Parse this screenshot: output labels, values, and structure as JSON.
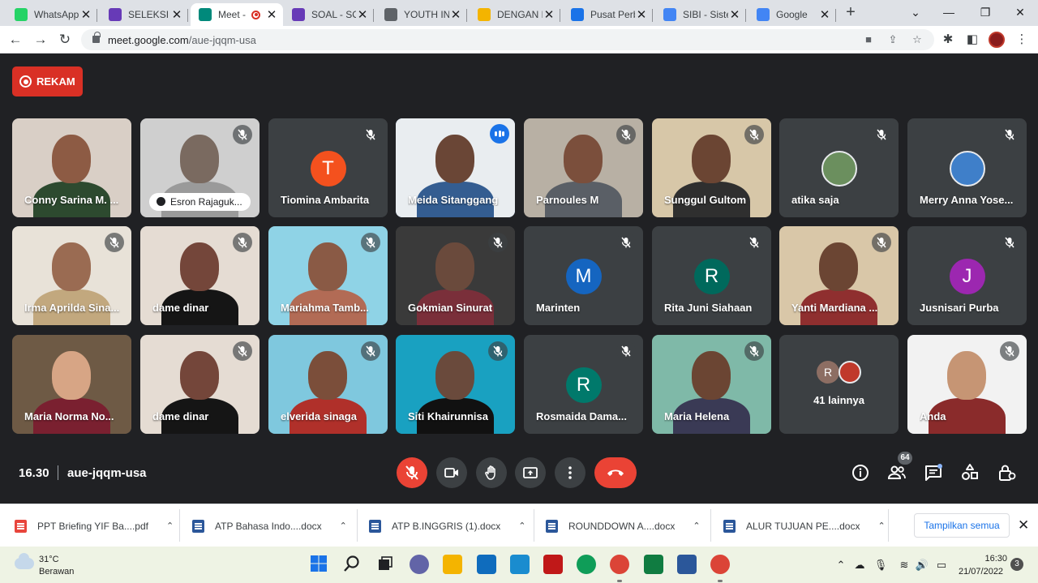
{
  "browser": {
    "tabs": [
      {
        "title": "WhatsApp",
        "favicon_color": "#25d366"
      },
      {
        "title": "SELEKSI TA",
        "favicon_color": "#673ab7"
      },
      {
        "title": "Meet -",
        "favicon_color": "#00897b",
        "recording": true,
        "active": true
      },
      {
        "title": "SOAL - SO",
        "favicon_color": "#673ab7"
      },
      {
        "title": "YOUTH IN",
        "favicon_color": "#5f6368"
      },
      {
        "title": "DENGAN E",
        "favicon_color": "#f4b400"
      },
      {
        "title": "Pusat Perb",
        "favicon_color": "#1a73e8"
      },
      {
        "title": "SIBI - Siste",
        "favicon_color": "#4285f4"
      },
      {
        "title": "Google",
        "favicon_color": "#4285f4"
      }
    ],
    "tab_close_glyph": "✕",
    "url_host": "meet.google.com",
    "url_path": "/aue-jqqm-usa"
  },
  "meet": {
    "record_label": "REKAM",
    "rows": [
      [
        {
          "name": "Conny Sarina M. ...",
          "kind": "video",
          "bg": "#d9cfc6",
          "skin": "#8d5b44",
          "cloth": "#2d4a2f",
          "mute": false
        },
        {
          "name": "Esron Rajaguk...",
          "kind": "video",
          "bg": "#cfcfcf",
          "skin": "#7a6a60",
          "cloth": "#9a9a9a",
          "mute": true,
          "pill": true
        },
        {
          "name": "Tiomina Ambarita",
          "kind": "avatar",
          "letter": "T",
          "color": "#f4511e",
          "mute": true
        },
        {
          "name": "Meida Sitanggang",
          "kind": "video",
          "bg": "#e9edf0",
          "skin": "#6a4636",
          "cloth": "#345d91",
          "mute": false,
          "speaking": true
        },
        {
          "name": "Parnoules M",
          "kind": "video",
          "bg": "#b8b0a4",
          "skin": "#7b4f3c",
          "cloth": "#5a5f66",
          "mute": true
        },
        {
          "name": "Sunggul Gultom",
          "kind": "video",
          "bg": "#d7c7a8",
          "skin": "#6b4533",
          "cloth": "#2f2f2f",
          "mute": true
        },
        {
          "name": "atika saja",
          "kind": "photo",
          "color": "#6b8f5e",
          "mute": true
        },
        {
          "name": "Merry Anna Yose...",
          "kind": "photo",
          "color": "#3f7fc9",
          "mute": true
        }
      ],
      [
        {
          "name": "Irma Aprilda Sina...",
          "kind": "video",
          "bg": "#e8e2d8",
          "skin": "#9a6b52",
          "cloth": "#c2a87e",
          "mute": true
        },
        {
          "name": "dame dinar",
          "kind": "video",
          "bg": "#e5dcd3",
          "skin": "#74463a",
          "cloth": "#151515",
          "mute": true
        },
        {
          "name": "Mariahma Tamb...",
          "kind": "video",
          "bg": "#8fd3e6",
          "skin": "#8a5a45",
          "cloth": "#b26b55",
          "mute": true
        },
        {
          "name": "Gokmian Sinurat",
          "kind": "video",
          "bg": "#3a3a3a",
          "skin": "#6a4a3c",
          "cloth": "#7a2f3a",
          "mute": true
        },
        {
          "name": "Marinten",
          "kind": "avatar",
          "letter": "M",
          "color": "#1565c0",
          "mute": true
        },
        {
          "name": "Rita Juni Siahaan",
          "kind": "avatar",
          "letter": "R",
          "color": "#00695c",
          "mute": true
        },
        {
          "name": "Yanti Mardiana ...",
          "kind": "video",
          "bg": "#d9c7a8",
          "skin": "#6b4533",
          "cloth": "#8f2f2f",
          "mute": true
        },
        {
          "name": "Jusnisari Purba",
          "kind": "avatar",
          "letter": "J",
          "color": "#9c27b0",
          "mute": true
        }
      ],
      [
        {
          "name": "Maria Norma No...",
          "kind": "video",
          "bg": "#6e5a45",
          "skin": "#d7a585",
          "cloth": "#7a2030",
          "mute": false
        },
        {
          "name": "dame dinar",
          "kind": "video",
          "bg": "#e5dcd3",
          "skin": "#74463a",
          "cloth": "#151515",
          "mute": true
        },
        {
          "name": "elverida sinaga",
          "kind": "video",
          "bg": "#7fc8de",
          "skin": "#7b4e3a",
          "cloth": "#b0302a",
          "mute": true
        },
        {
          "name": "Siti Khairunnisa",
          "kind": "video",
          "bg": "#19a1c1",
          "skin": "#6a4a3c",
          "cloth": "#111111",
          "mute": true
        },
        {
          "name": "Rosmaida Dama...",
          "kind": "avatar",
          "letter": "R",
          "color": "#00796b",
          "mute": true
        },
        {
          "name": "Maria Helena",
          "kind": "video",
          "bg": "#7fb9a8",
          "skin": "#6b4533",
          "cloth": "#3a3a55",
          "mute": true
        },
        {
          "name": "41 lainnya",
          "kind": "others",
          "avatar_letter": "R",
          "avatar_color": "#8d6e63"
        },
        {
          "name": "Anda",
          "kind": "video",
          "bg": "#f2f2f2",
          "skin": "#c69574",
          "cloth": "#8a2b2b",
          "mute": true
        }
      ]
    ]
  },
  "controls": {
    "time": "16.30",
    "meeting_code": "aue-jqqm-usa",
    "people_count": "64",
    "mic_muted": true
  },
  "downloads": {
    "items": [
      {
        "name": "PPT Briefing YIF Ba....pdf",
        "type": "pdf"
      },
      {
        "name": "ATP Bahasa Indo....docx",
        "type": "doc"
      },
      {
        "name": "ATP B.INGGRIS (1).docx",
        "type": "doc"
      },
      {
        "name": "ROUNDDOWN A....docx",
        "type": "doc"
      },
      {
        "name": "ALUR TUJUAN PE....docx",
        "type": "doc"
      }
    ],
    "show_all": "Tampilkan semua"
  },
  "taskbar": {
    "temperature": "31°C",
    "condition": "Berawan",
    "time": "16:30",
    "date": "21/07/2022",
    "notifications": "3",
    "apps": [
      {
        "name": "windows-start-icon",
        "color": "#1a73e8"
      },
      {
        "name": "search-icon",
        "color": "#202124"
      },
      {
        "name": "task-view-icon",
        "color": "#202124"
      },
      {
        "name": "teams-chat-icon",
        "color": "#6264a7"
      },
      {
        "name": "file-explorer-icon",
        "color": "#f4b400"
      },
      {
        "name": "mail-icon",
        "color": "#0f6cbd"
      },
      {
        "name": "app-l-icon",
        "color": "#1a8ccf"
      },
      {
        "name": "mcafee-icon",
        "color": "#c01818"
      },
      {
        "name": "edge-icon",
        "color": "#0f9d58"
      },
      {
        "name": "chrome-icon",
        "color": "#db4437"
      },
      {
        "name": "excel-icon",
        "color": "#107c41"
      },
      {
        "name": "word-icon",
        "color": "#2b579a"
      },
      {
        "name": "chrome-running-icon",
        "color": "#db4437"
      }
    ]
  }
}
